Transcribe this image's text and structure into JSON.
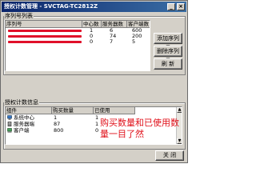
{
  "window": {
    "title": "授权计数管理 - SVCTAG-TC2812Z",
    "min": "_",
    "close": "×"
  },
  "serial_group": {
    "title": "序列号列表",
    "columns": [
      "序列号",
      "中心数",
      "服务器数",
      "客户端数"
    ],
    "rows": [
      {
        "center": "1",
        "server": "6",
        "client": "600"
      },
      {
        "center": "0",
        "server": "74",
        "client": "200"
      },
      {
        "center": "0",
        "server": "7",
        "client": "5"
      }
    ],
    "buttons": {
      "add": "添加序列号",
      "delete": "删除序列号",
      "refresh": "刷 新"
    }
  },
  "stats_group": {
    "title": "授权计数信息",
    "columns": [
      "组件",
      "购买数量",
      "已使用"
    ],
    "rows": [
      {
        "name": "系统中心",
        "bought": "1",
        "used": "1"
      },
      {
        "name": "服务器端",
        "bought": "87",
        "used": "1"
      },
      {
        "name": "客户端",
        "bought": "800",
        "used": "0"
      }
    ]
  },
  "annotation": {
    "line1": "购买数量和已使用数",
    "line2": "量一目了然"
  },
  "close_button": "关 闭",
  "colors": {
    "redaction": "#e0102a",
    "annotation": "#e0101a",
    "titlebar": "#0a246a"
  },
  "icons": [
    "system-center-icon",
    "server-icon",
    "client-icon"
  ]
}
